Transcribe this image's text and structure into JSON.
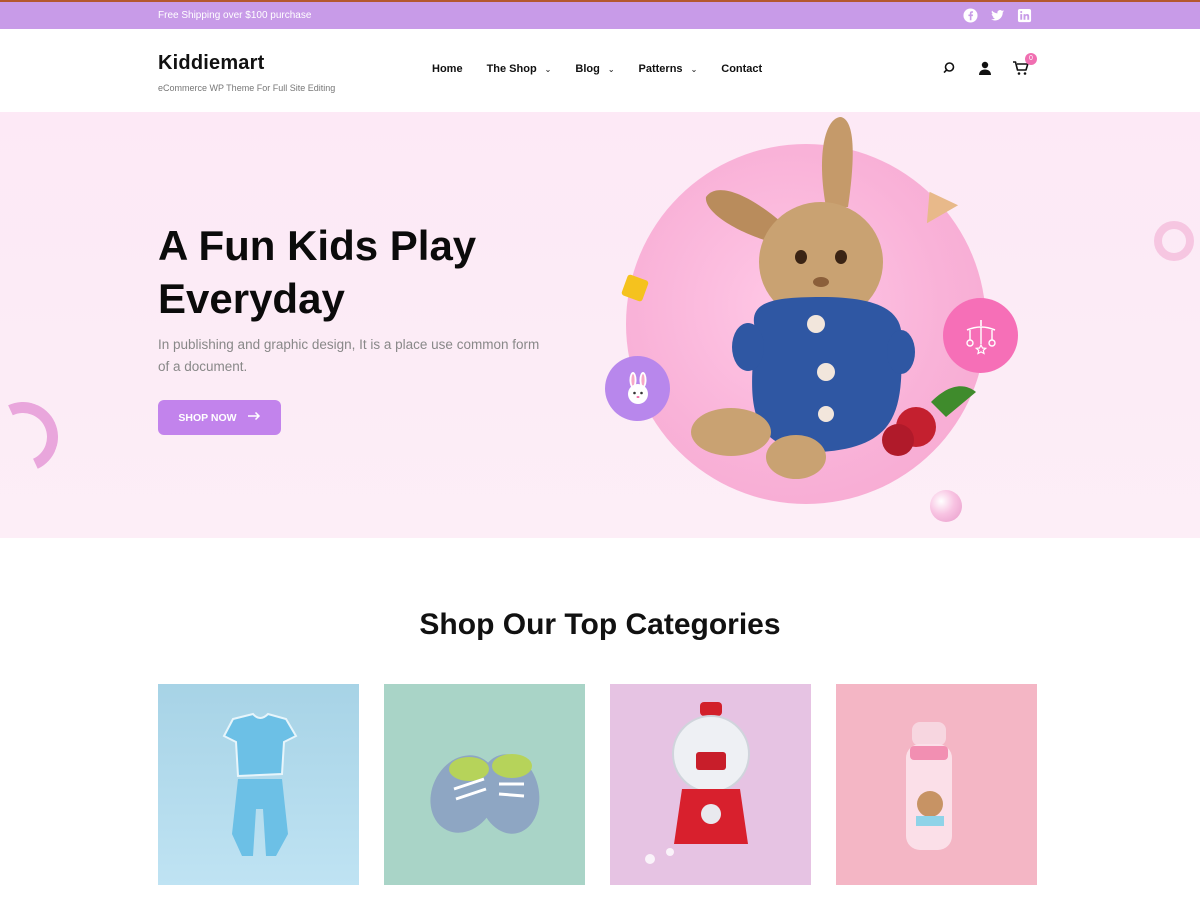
{
  "topbar": {
    "shipping_text": "Free Shipping over $100 purchase",
    "social": [
      "facebook-icon",
      "twitter-icon",
      "linkedin-icon"
    ]
  },
  "header": {
    "brand": "Kiddiemart",
    "tagline": "eCommerce WP Theme For Full Site Editing",
    "nav": [
      {
        "label": "Home"
      },
      {
        "label": "The Shop"
      },
      {
        "label": "Blog"
      },
      {
        "label": "Patterns"
      },
      {
        "label": "Contact"
      }
    ],
    "cart_count": "0"
  },
  "hero": {
    "title": "A Fun Kids Play Everyday",
    "description": "In publishing and graphic design, It is a place use common form of a document.",
    "button_label": "SHOP NOW"
  },
  "categories": {
    "title": "Shop Our Top Categories",
    "items": [
      {
        "image": "baby-clothes",
        "bg": "#a9d6e8"
      },
      {
        "image": "baby-shoes",
        "bg": "#a9d6c9"
      },
      {
        "image": "candy-machine",
        "bg": "#e7c4e4"
      },
      {
        "image": "baby-bottle",
        "bg": "#f4b7c6"
      }
    ]
  },
  "colors": {
    "topbar": "#c89be8",
    "accent": "#c283ec",
    "pink": "#f66fb7",
    "hero_bg": "#fde9f6"
  }
}
